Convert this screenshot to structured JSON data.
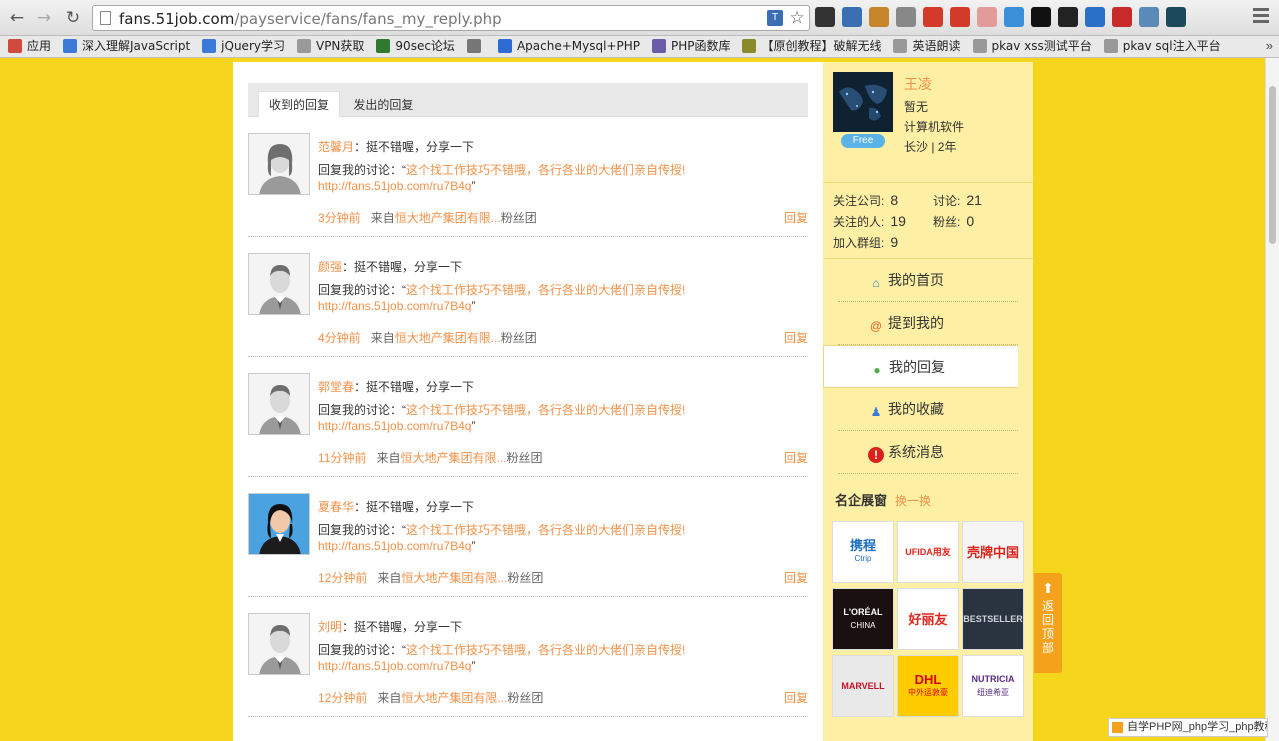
{
  "browser": {
    "url_host": "fans.51job.com",
    "url_path": "/payservice/fans/fans_my_reply.php",
    "bookmarks": [
      {
        "label": "应用",
        "color": "#d24a3e"
      },
      {
        "label": "深入理解JavaScript",
        "color": "#3d79d9"
      },
      {
        "label": "jQuery学习",
        "color": "#3d79d9"
      },
      {
        "label": "VPN获取",
        "color": "#999999"
      },
      {
        "label": "90sec论坛",
        "color": "#2f7a2f"
      },
      {
        "label": "",
        "color": "#777777"
      },
      {
        "label": "Apache+Mysql+PHP",
        "color": "#2e6bd3"
      },
      {
        "label": "PHP函数库",
        "color": "#6b5ba8"
      },
      {
        "label": "【原创教程】破解无线",
        "color": "#8a8a2a"
      },
      {
        "label": "英语朗读",
        "color": "#999999"
      },
      {
        "label": "pkav xss测试平台",
        "color": "#999999"
      },
      {
        "label": "pkav sql注入平台",
        "color": "#999999"
      }
    ],
    "extensions": [
      "#333333",
      "#3b6fb3",
      "#c8862c",
      "#888888",
      "#d43a2a",
      "#d43a2a",
      "#e39a9a",
      "#3a8fd8",
      "#111111",
      "#222222",
      "#2a6fc8",
      "#c82a2a",
      "#5a8ab8",
      "#1d4a5a"
    ]
  },
  "tabs": [
    {
      "label": "收到的回复",
      "active": true
    },
    {
      "label": "发出的回复",
      "active": false
    }
  ],
  "replies": [
    {
      "name": "范馨月",
      "text": "挺不错喔，分享一下",
      "prefix": "回复我的讨论：“",
      "topic": "这个找工作技巧不错哦，各行各业的大佬们亲自传授!",
      "link": "http://fans.51job.com/ru7B4q",
      "suffix": "”",
      "time": "3分钟前",
      "from_prefix": "来自",
      "group": "恒大地产集团有限...",
      "group_suffix": "粉丝团",
      "reply": "回复",
      "avatar": "female"
    },
    {
      "name": "颜强",
      "text": "挺不错喔，分享一下",
      "prefix": "回复我的讨论：“",
      "topic": "这个找工作技巧不错哦，各行各业的大佬们亲自传授!",
      "link": "http://fans.51job.com/ru7B4q",
      "suffix": "”",
      "time": "4分钟前",
      "from_prefix": "来自",
      "group": "恒大地产集团有限...",
      "group_suffix": "粉丝团",
      "reply": "回复",
      "avatar": "male"
    },
    {
      "name": "郭堂春",
      "text": "挺不错喔，分享一下",
      "prefix": "回复我的讨论：“",
      "topic": "这个找工作技巧不错哦，各行各业的大佬们亲自传授!",
      "link": "http://fans.51job.com/ru7B4q",
      "suffix": "”",
      "time": "11分钟前",
      "from_prefix": "来自",
      "group": "恒大地产集团有限...",
      "group_suffix": "粉丝团",
      "reply": "回复",
      "avatar": "male"
    },
    {
      "name": "夏春华",
      "text": "挺不错喔，分享一下",
      "prefix": "回复我的讨论：“",
      "topic": "这个找工作技巧不错哦，各行各业的大佬们亲自传授!",
      "link": "http://fans.51job.com/ru7B4q",
      "suffix": "”",
      "time": "12分钟前",
      "from_prefix": "来自",
      "group": "恒大地产集团有限...",
      "group_suffix": "粉丝团",
      "reply": "回复",
      "avatar": "photo"
    },
    {
      "name": "刘明",
      "text": "挺不错喔，分享一下",
      "prefix": "回复我的讨论：“",
      "topic": "这个找工作技巧不错哦，各行各业的大佬们亲自传授!",
      "link": "http://fans.51job.com/ru7B4q",
      "suffix": "”",
      "time": "12分钟前",
      "from_prefix": "来自",
      "group": "恒大地产集团有限...",
      "group_suffix": "粉丝团",
      "reply": "回复",
      "avatar": "male"
    }
  ],
  "profile": {
    "name": "王凌",
    "line1": "暂无",
    "line2": "计算机软件",
    "line3": "长沙 | 2年",
    "badge": "Free"
  },
  "stats": {
    "companies_label": "关注公司:",
    "companies": "8",
    "discussions_label": "讨论:",
    "discussions": "21",
    "people_label": "关注的人:",
    "people": "19",
    "fans_label": "粉丝:",
    "fans": "0",
    "groups_label": "加入群组:",
    "groups": "9"
  },
  "side_nav": [
    {
      "label": "我的首页",
      "icon": "home-icon",
      "color": "#3a7bd5",
      "glyph": "⌂",
      "active": false
    },
    {
      "label": "提到我的",
      "icon": "at-icon",
      "color": "#e5602a",
      "glyph": "@",
      "active": false
    },
    {
      "label": "我的回复",
      "icon": "comment-icon",
      "color": "#4cae4c",
      "glyph": "●",
      "active": true
    },
    {
      "label": "我的收藏",
      "icon": "favorite-icon",
      "color": "#3a7bd5",
      "glyph": "♟",
      "active": false
    },
    {
      "label": "系统消息",
      "icon": "info-icon",
      "color": "#d9221c",
      "glyph": "!",
      "active": false
    }
  ],
  "brands_title": "名企展窗",
  "brands_switch": "换一换",
  "brands": [
    {
      "name": "ctrip-logo",
      "text": "携程",
      "sub": "Ctrip",
      "bg": "#ffffff",
      "color": "#1d6fc0"
    },
    {
      "name": "ufida-logo",
      "text": "UFIDA用友",
      "sub": "",
      "bg": "#ffffff",
      "color": "#e1251b"
    },
    {
      "name": "shell-logo",
      "text": "壳牌中国",
      "sub": "",
      "bg": "#f5f5f5",
      "color": "#d8251d"
    },
    {
      "name": "loreal-logo",
      "text": "L'ORÉAL",
      "sub": "CHINA",
      "bg": "#1a1010",
      "color": "#ffffff"
    },
    {
      "name": "orion-logo",
      "text": "好丽友",
      "sub": "",
      "bg": "#ffffff",
      "color": "#e1251b"
    },
    {
      "name": "bestseller-logo",
      "text": "BESTSELLER",
      "sub": "",
      "bg": "#2a3340",
      "color": "#cfd4da"
    },
    {
      "name": "marvell-logo",
      "text": "MARVELL",
      "sub": "",
      "bg": "#e9e9e9",
      "color": "#c8102e"
    },
    {
      "name": "dhl-logo",
      "text": "DHL",
      "sub": "中外运敦豪",
      "bg": "#ffcc00",
      "color": "#d40511"
    },
    {
      "name": "nutricia-logo",
      "text": "NUTRICIA",
      "sub": "纽迪希亚",
      "bg": "#ffffff",
      "color": "#5b2b82"
    }
  ],
  "back_top": "返回顶部",
  "status_tip": "自学PHP网_php学习_php教程"
}
